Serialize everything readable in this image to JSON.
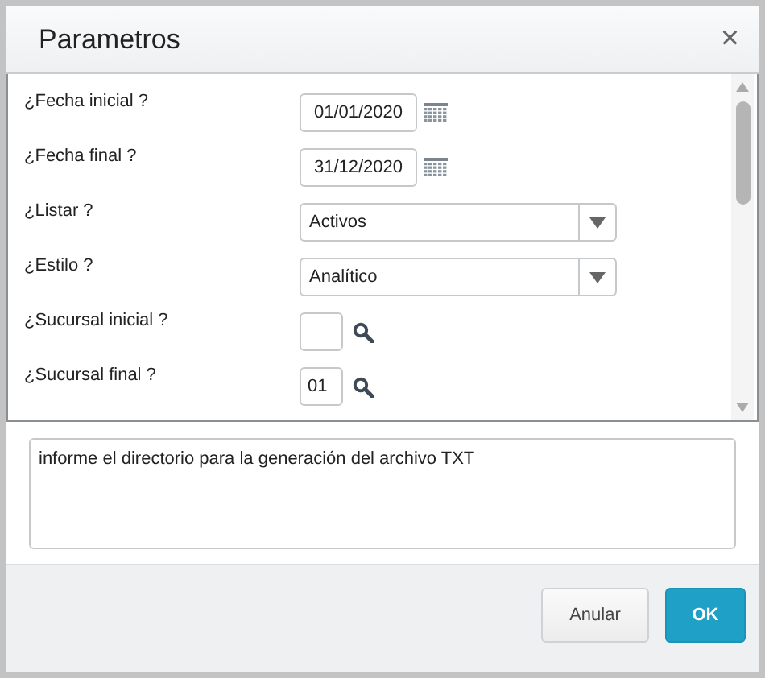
{
  "window": {
    "title": "Parametros",
    "close": "×"
  },
  "fields": [
    {
      "kind": "date",
      "label": "¿Fecha inicial ?",
      "value": "01/01/2020"
    },
    {
      "kind": "date",
      "label": "¿Fecha final ?",
      "value": "31/12/2020"
    },
    {
      "kind": "select",
      "label": "¿Listar ?",
      "value": "Activos"
    },
    {
      "kind": "select",
      "label": "¿Estilo ?",
      "value": "Analítico"
    },
    {
      "kind": "lookup",
      "label": "¿Sucursal inicial ?"
    },
    {
      "kind": "lookup",
      "label": "¿Sucursal final ?",
      "value": "01"
    }
  ],
  "help_text": "informe el directorio para la generación del archivo TXT",
  "buttons": [
    {
      "label": "Anular",
      "kind": "secondary"
    },
    {
      "label": "OK",
      "kind": "primary"
    }
  ]
}
